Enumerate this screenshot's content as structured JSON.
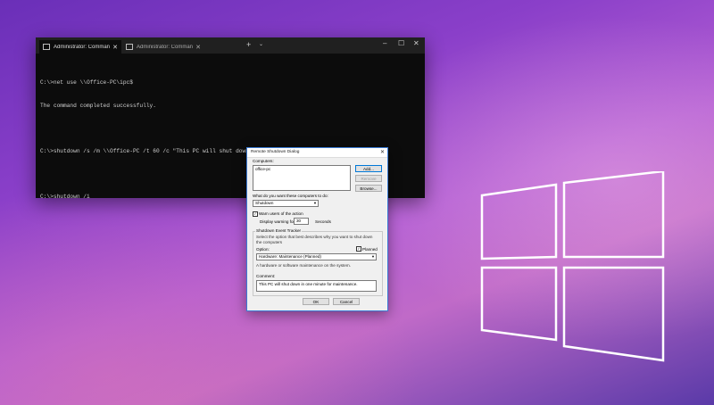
{
  "terminal": {
    "tabs": [
      {
        "label": "Administrator: Command Prom",
        "active": true
      },
      {
        "label": "Administrator: Command Prom",
        "active": false
      }
    ],
    "lines": [
      "C:\\>net use \\\\Office-PC\\ipc$",
      "The command completed successfully.",
      "",
      "C:\\>shutdown /s /m \\\\Office-PC /t 60 /c \"This PC will shut down in one minute for maintenance.\" /f",
      "",
      "C:\\>shutdown /i"
    ]
  },
  "dialog": {
    "title": "Remote Shutdown Dialog",
    "computers_label": "Computers:",
    "computers": [
      "office-pc"
    ],
    "add_label": "Add...",
    "remove_label": "Remove",
    "browse_label": "Browse...",
    "action_prompt": "What do you want these computers to do:",
    "action_value": "Shutdown",
    "warn_label": "Warn users of the action",
    "warn_checked": true,
    "display_warning_label": "Display warning for",
    "warning_seconds": "30",
    "seconds_label": "Seconds",
    "tracker_title": "Shutdown Event Tracker",
    "tracker_description": "Select the option that best describes why you want to shut down the computers",
    "option_label": "Option:",
    "planned_label": "Planned",
    "planned_checked": true,
    "option_value": "Hardware: Maintenance (Planned)",
    "option_description": "A hardware or software maintenance on the system.",
    "comment_label": "Comment:",
    "comment_value": "This PC will shut down in one minute for maintenance.",
    "ok_label": "OK",
    "cancel_label": "Cancel"
  }
}
